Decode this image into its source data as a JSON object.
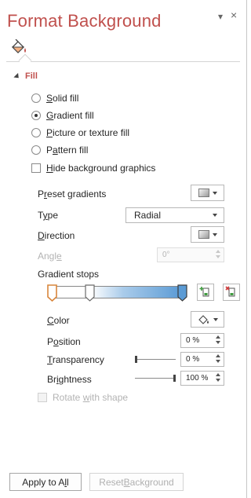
{
  "pane": {
    "title": "Format Background",
    "dropdown_glyph": "▾",
    "close_glyph": "×",
    "tab_icon": "paint-bucket-icon"
  },
  "fill": {
    "section_label": "Fill",
    "options": [
      {
        "pre": "",
        "key": "S",
        "post": "olid fill",
        "selected": false
      },
      {
        "pre": "",
        "key": "G",
        "post": "radient fill",
        "selected": true
      },
      {
        "pre": "",
        "key": "P",
        "post": "icture or texture fill",
        "selected": false
      },
      {
        "pre": "P",
        "key": "a",
        "post": "ttern fill",
        "selected": false
      }
    ],
    "hide_graphics": {
      "pre": "",
      "key": "H",
      "post": "ide background graphics",
      "checked": false
    }
  },
  "gradient": {
    "preset": {
      "pre": "P",
      "key": "r",
      "post": "eset gradients"
    },
    "type": {
      "pre": "T",
      "key": "y",
      "post": "pe",
      "value": "Radial"
    },
    "direction": {
      "pre": "",
      "key": "D",
      "post": "irection"
    },
    "angle": {
      "pre": "Angl",
      "key": "e",
      "post": "",
      "value": "0°",
      "enabled": false
    },
    "stops_label": "Gradient stops",
    "color": {
      "pre": "",
      "key": "C",
      "post": "olor"
    },
    "position": {
      "pre": "P",
      "key": "o",
      "post": "sition",
      "value": "0 %"
    },
    "transparency": {
      "pre": "",
      "key": "T",
      "post": "ransparency",
      "value": "0 %",
      "level": 0
    },
    "brightness": {
      "pre": "Br",
      "key": "i",
      "post": "ghtness",
      "value": "100 %",
      "level": 1
    },
    "rotate": {
      "pre": "Rotate ",
      "key": "w",
      "post": "ith shape",
      "checked": false,
      "enabled": false
    }
  },
  "footer": {
    "apply_all": {
      "pre": "Apply to A",
      "key": "l",
      "post": "l"
    },
    "reset": {
      "pre": "Reset ",
      "key": "B",
      "post": "ackground",
      "enabled": false
    }
  },
  "colors": {
    "accent": "#c0504d",
    "gradient_end": "#5b9bd5",
    "text": "#262626",
    "disabled": "#b3b3b3"
  }
}
